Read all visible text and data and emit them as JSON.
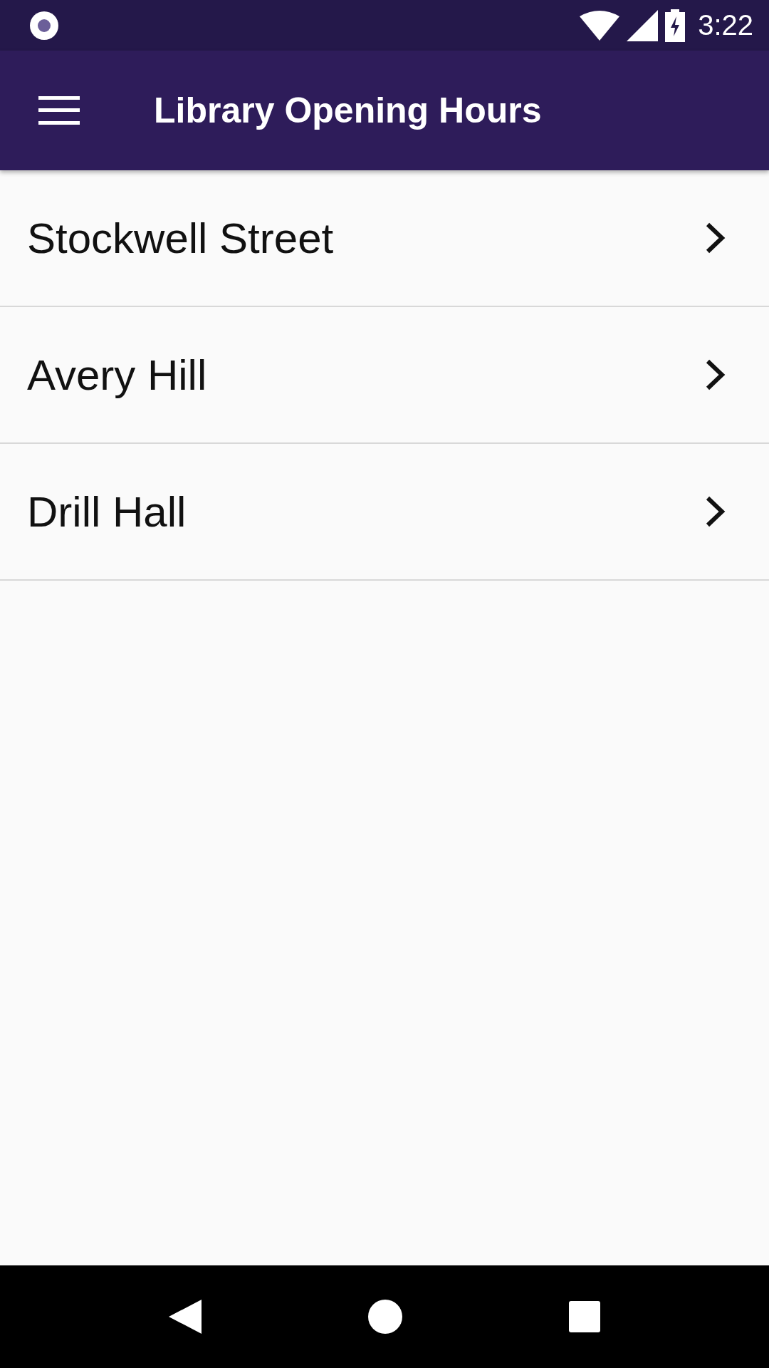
{
  "status_bar": {
    "time": "3:22"
  },
  "app_bar": {
    "title": "Library Opening Hours"
  },
  "locations": [
    {
      "name": "Stockwell Street"
    },
    {
      "name": "Avery Hill"
    },
    {
      "name": "Drill Hall"
    }
  ]
}
